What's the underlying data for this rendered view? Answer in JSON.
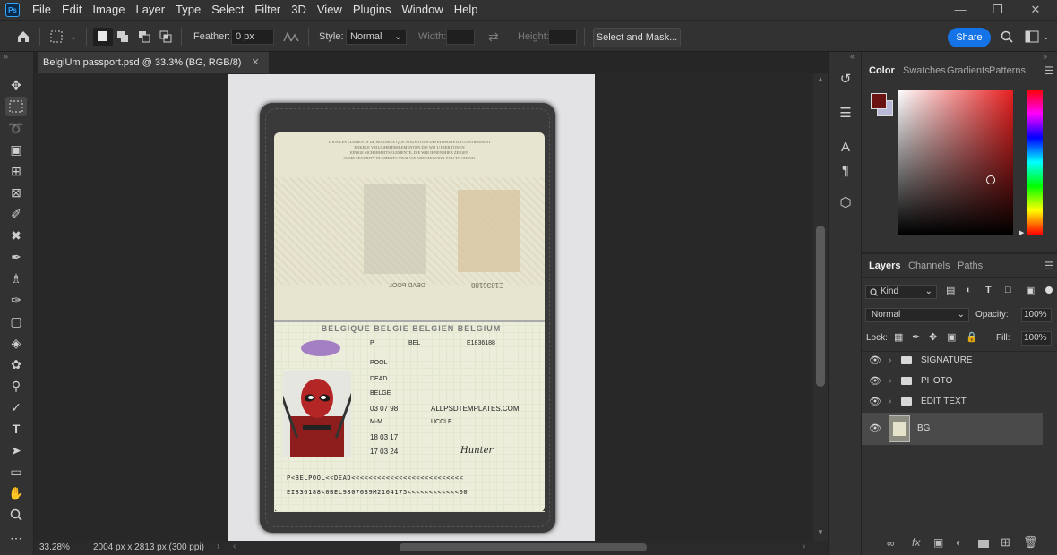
{
  "app": {
    "logo": "Ps",
    "menu": [
      "File",
      "Edit",
      "Image",
      "Layer",
      "Type",
      "Select",
      "Filter",
      "3D",
      "View",
      "Plugins",
      "Window",
      "Help"
    ]
  },
  "options": {
    "feather_label": "Feather:",
    "feather_value": "0 px",
    "style_label": "Style:",
    "style_value": "Normal",
    "width_label": "Width:",
    "height_label": "Height:",
    "select_mask_label": "Select and Mask...",
    "share_label": "Share"
  },
  "document": {
    "tab_title": "BelgiUm passport.psd @ 33.3% (BG, RGB/8)",
    "zoom": "33.28%",
    "dimensions": "2004 px x 2813 px (300 ppi)"
  },
  "passport": {
    "security_text": [
      "TOUS LES ELEMENTS DE SECURITE QUE NOUS VOUS DEFINISSONS ICI CONTIENNENT",
      "ENKELE VEILIGHEIDSELEMENTEN DIE WIJ U HIER TONEN",
      "EINIGE SICHERHEITSELEMENTE, DIE WIR IHNEN HIER ZEIGEN",
      "SOME SECURITY ELEMENTS THAT WE ARE SHOWING YOU TO CHECK"
    ],
    "top_mirror_number": "E1836188",
    "top_mirror_name": "DEAD POOL",
    "header": "BELGIQUE  BELGIE  BELGIEN  BELGIUM",
    "type": "P",
    "code": "BEL",
    "number": "E1836188",
    "surname": "POOL",
    "given_name": "DEAD",
    "nationality": "BELGE",
    "dob": "03 07 98",
    "sex": "M-M",
    "birth_place": "ALLPSDTEMPLATES.COM",
    "issue_date": "18 03 17",
    "authority": "UCCLE",
    "expiry_date": "17 03 24",
    "signature": "Hunter",
    "mrz1": "P<BELPOOL<<DEAD<<<<<<<<<<<<<<<<<<<<<<<<<<",
    "mrz2": "EI836188<0BEL9807039M2104175<<<<<<<<<<<<00"
  },
  "panels": {
    "color_tabs": [
      "Color",
      "Swatches",
      "Gradients",
      "Patterns"
    ],
    "fg_color": "#6b1212",
    "bg_color": "#b8b8d8",
    "layers_tabs": [
      "Layers",
      "Channels",
      "Paths"
    ],
    "kind_label": "Kind",
    "blend_mode": "Normal",
    "opacity_label": "Opacity:",
    "opacity_value": "100%",
    "lock_label": "Lock:",
    "fill_label": "Fill:",
    "fill_value": "100%"
  },
  "layers": [
    {
      "name": "SIGNATURE",
      "type": "group"
    },
    {
      "name": "PHOTO",
      "type": "group"
    },
    {
      "name": "EDIT TEXT",
      "type": "group"
    },
    {
      "name": "BG",
      "type": "image"
    }
  ],
  "icons": [
    "home-icon",
    "marquee-icon",
    "move-icon",
    "lasso-icon",
    "crop-icon",
    "brush-icon",
    "eraser-icon",
    "type-icon",
    "hand-icon",
    "zoom-icon",
    "search-icon",
    "eye-icon",
    "folder-icon",
    "trash-icon"
  ]
}
